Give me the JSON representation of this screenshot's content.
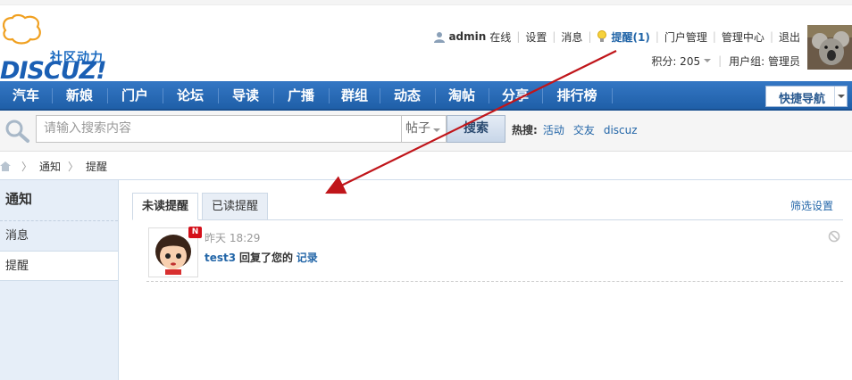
{
  "brand": {
    "tagline": "社区动力",
    "wordmark": "DISCUZ!"
  },
  "userbar": {
    "username": "admin",
    "status": "在线",
    "links": [
      "设置",
      "消息"
    ],
    "remind": "提醒(1)",
    "links2": [
      "门户管理",
      "管理中心",
      "退出"
    ],
    "credits": "积分: 205",
    "usergroup": "用户组: 管理员"
  },
  "nav": {
    "items": [
      "汽车",
      "新娘",
      "门户",
      "论坛",
      "导读",
      "广播",
      "群组",
      "动态",
      "淘帖",
      "分享",
      "排行榜"
    ],
    "quick_nav": "快捷导航"
  },
  "search": {
    "placeholder": "请输入搜索内容",
    "type": "帖子",
    "button": "搜索",
    "hot_label": "热搜:",
    "hot_keywords": [
      "活动",
      "交友",
      "discuz"
    ]
  },
  "breadcrumb": [
    "通知",
    "提醒"
  ],
  "sidebar": {
    "title": "通知",
    "items": [
      {
        "label": "消息",
        "active": false
      },
      {
        "label": "提醒",
        "active": true
      }
    ]
  },
  "tabs": {
    "unread": "未读提醒",
    "read": "已读提醒",
    "filter": "筛选设置"
  },
  "notices": [
    {
      "badge": "N",
      "time": "昨天 18:29",
      "user": "test3",
      "verb": "回复了您的",
      "object": "记录"
    }
  ],
  "colors": {
    "nav_bg": "#2a6cb8",
    "link": "#2366a8",
    "sidebar_bg": "#e6eef8",
    "annotation_arrow": "#c0151a"
  }
}
